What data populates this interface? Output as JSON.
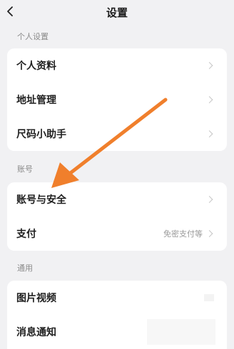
{
  "header": {
    "title": "设置"
  },
  "sections": [
    {
      "title": "个人设置",
      "items": [
        {
          "label": "个人资料"
        },
        {
          "label": "地址管理"
        },
        {
          "label": "尺码小助手"
        }
      ]
    },
    {
      "title": "账号",
      "items": [
        {
          "label": "账号与安全"
        },
        {
          "label": "支付",
          "value": "免密支付等"
        }
      ]
    },
    {
      "title": "通用",
      "items": [
        {
          "label": "图片视频"
        },
        {
          "label": "消息通知"
        }
      ]
    }
  ],
  "colors": {
    "background": "#f1f1f3",
    "card": "#ffffff",
    "annotation_arrow": "#f07f2c"
  }
}
